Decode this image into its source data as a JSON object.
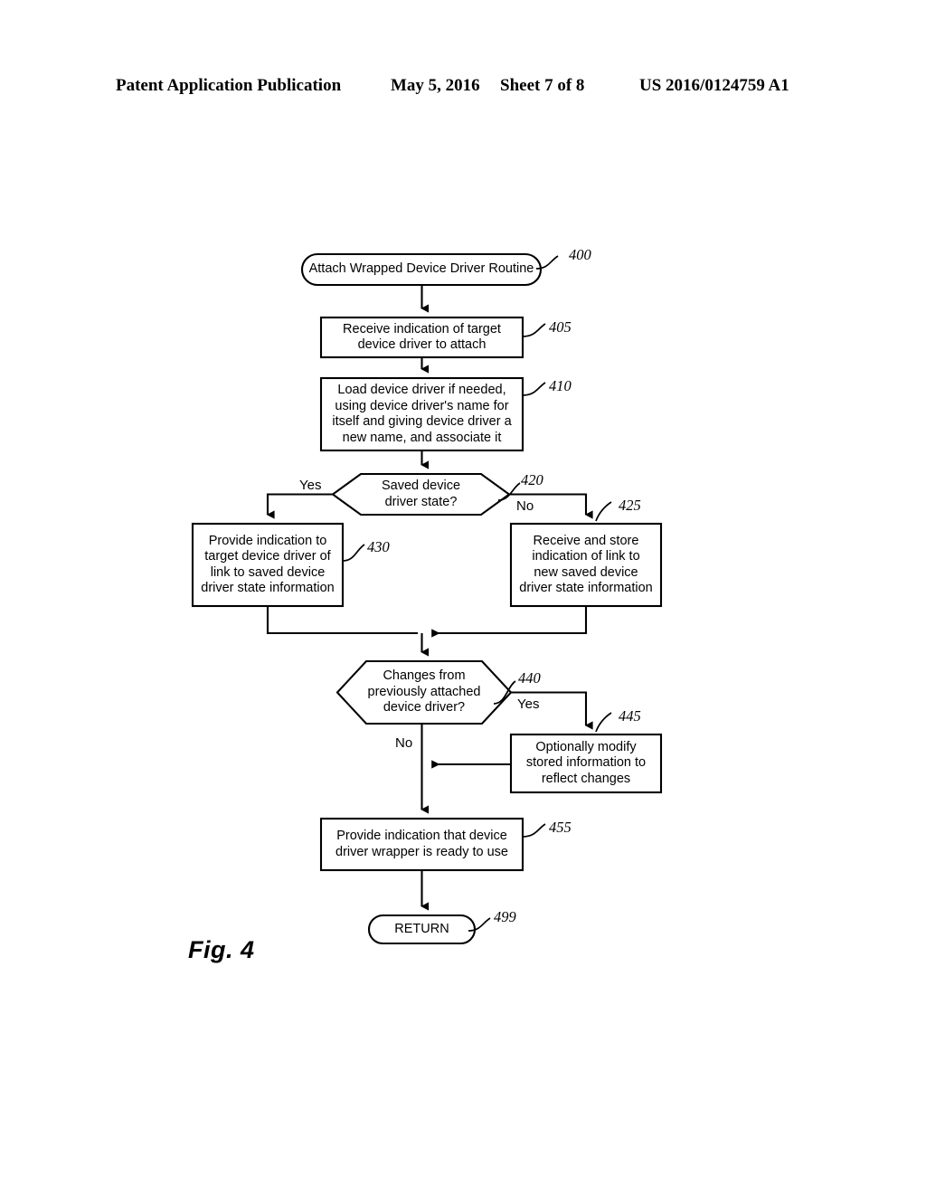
{
  "header": {
    "publication": "Patent Application Publication",
    "date": "May 5, 2016",
    "sheet": "Sheet 7 of 8",
    "patent_number": "US 2016/0124759 A1"
  },
  "figure": {
    "caption": "Fig. 4"
  },
  "flowchart": {
    "nodes": [
      {
        "id": "n400",
        "ref": "400",
        "shape": "terminal",
        "text": "Attach Wrapped Device Driver Routine"
      },
      {
        "id": "n405",
        "ref": "405",
        "shape": "process",
        "text": "Receive indication of target\ndevice driver to attach"
      },
      {
        "id": "n410",
        "ref": "410",
        "shape": "process",
        "text": "Load device driver if needed,\nusing device driver's name for\nitself and giving device driver a\nnew name, and associate it"
      },
      {
        "id": "n420",
        "ref": "420",
        "shape": "decision",
        "text": "Saved device\ndriver state?"
      },
      {
        "id": "n430",
        "ref": "430",
        "shape": "process",
        "text": "Provide indication to\ntarget device driver of\nlink to saved device\ndriver state information"
      },
      {
        "id": "n425",
        "ref": "425",
        "shape": "process",
        "text": "Receive and store\nindication of link to\nnew saved device\ndriver state information"
      },
      {
        "id": "n440",
        "ref": "440",
        "shape": "decision",
        "text": "Changes from\npreviously attached\ndevice driver?"
      },
      {
        "id": "n445",
        "ref": "445",
        "shape": "process",
        "text": "Optionally modify\nstored information to\nreflect changes"
      },
      {
        "id": "n455",
        "ref": "455",
        "shape": "process",
        "text": "Provide indication that device\ndriver wrapper is ready to use"
      },
      {
        "id": "n499",
        "ref": "499",
        "shape": "terminal",
        "text": "RETURN"
      }
    ],
    "branch_labels": {
      "d420_yes": "Yes",
      "d420_no": "No",
      "d440_yes": "Yes",
      "d440_no": "No"
    }
  },
  "colors": {
    "ink": "#000000",
    "page": "#ffffff"
  }
}
